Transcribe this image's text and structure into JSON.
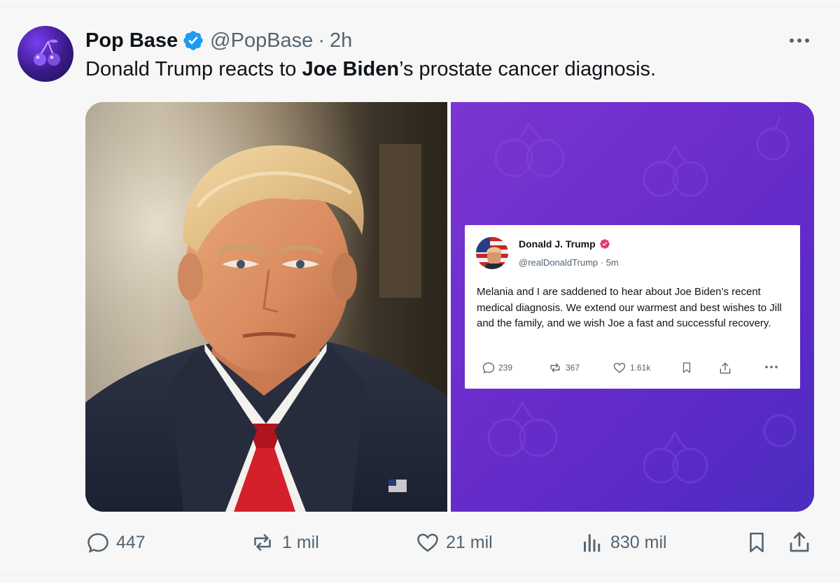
{
  "author": {
    "name": "Pop Base",
    "handle": "@PopBase",
    "separator": "·",
    "time": "2h"
  },
  "tweet": {
    "text_before": "Donald Trump reacts to ",
    "text_bold": "Joe Biden",
    "text_after": "’s prostate cancer diagnosis."
  },
  "embedded_post": {
    "name": "Donald J. Trump",
    "handle_time": "@realDonaldTrump · 5m",
    "text": "Melania and I are saddened to hear about Joe Biden’s recent medical diagnosis. We extend our warmest and best wishes to Jill and the family, and we wish Joe a fast and successful recovery.",
    "replies": "239",
    "reposts": "367",
    "likes": "1.61k"
  },
  "actions": {
    "replies": "447",
    "reposts": "1 mil",
    "likes": "21 mil",
    "views": "830 mil"
  },
  "colors": {
    "verified": "#1d9bf0",
    "text_secondary": "#536471",
    "card_purple": "#6a2dcb",
    "tie_red": "#d4202a"
  },
  "icons": [
    "verified-badge-icon",
    "more-icon",
    "reply-icon",
    "repost-icon",
    "like-icon",
    "views-icon",
    "bookmark-icon",
    "share-icon"
  ]
}
